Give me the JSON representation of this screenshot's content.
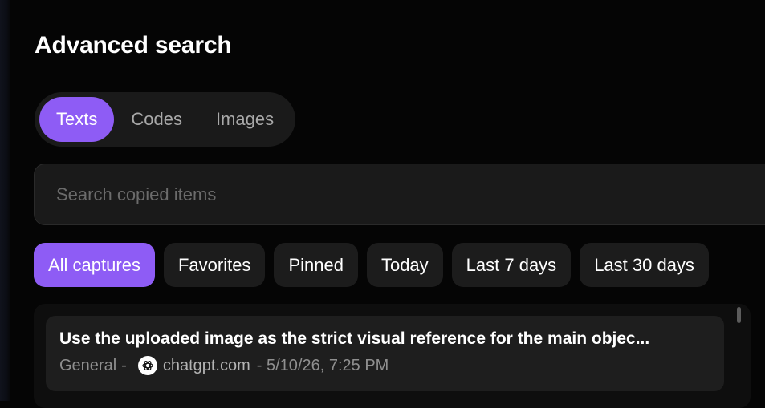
{
  "header": {
    "title": "Advanced search"
  },
  "type_tabs": [
    {
      "label": "Texts",
      "active": true
    },
    {
      "label": "Codes",
      "active": false
    },
    {
      "label": "Images",
      "active": false
    }
  ],
  "search": {
    "placeholder": "Search copied items",
    "value": ""
  },
  "filters": [
    {
      "label": "All captures",
      "active": true
    },
    {
      "label": "Favorites",
      "active": false
    },
    {
      "label": "Pinned",
      "active": false
    },
    {
      "label": "Today",
      "active": false
    },
    {
      "label": "Last 7 days",
      "active": false
    },
    {
      "label": "Last 30 days",
      "active": false
    }
  ],
  "results": [
    {
      "title": "Use the uploaded image as the strict visual reference for the main objec...",
      "collection": "General",
      "separator": "-",
      "source_icon": "chatgpt-logo-icon",
      "source": "chatgpt.com",
      "timestamp": "- 5/10/26, 7:25 PM"
    }
  ],
  "colors": {
    "accent": "#8e5cf5",
    "background": "#050505",
    "surface": "#1a1a1a",
    "card": "#1e1e1e"
  }
}
